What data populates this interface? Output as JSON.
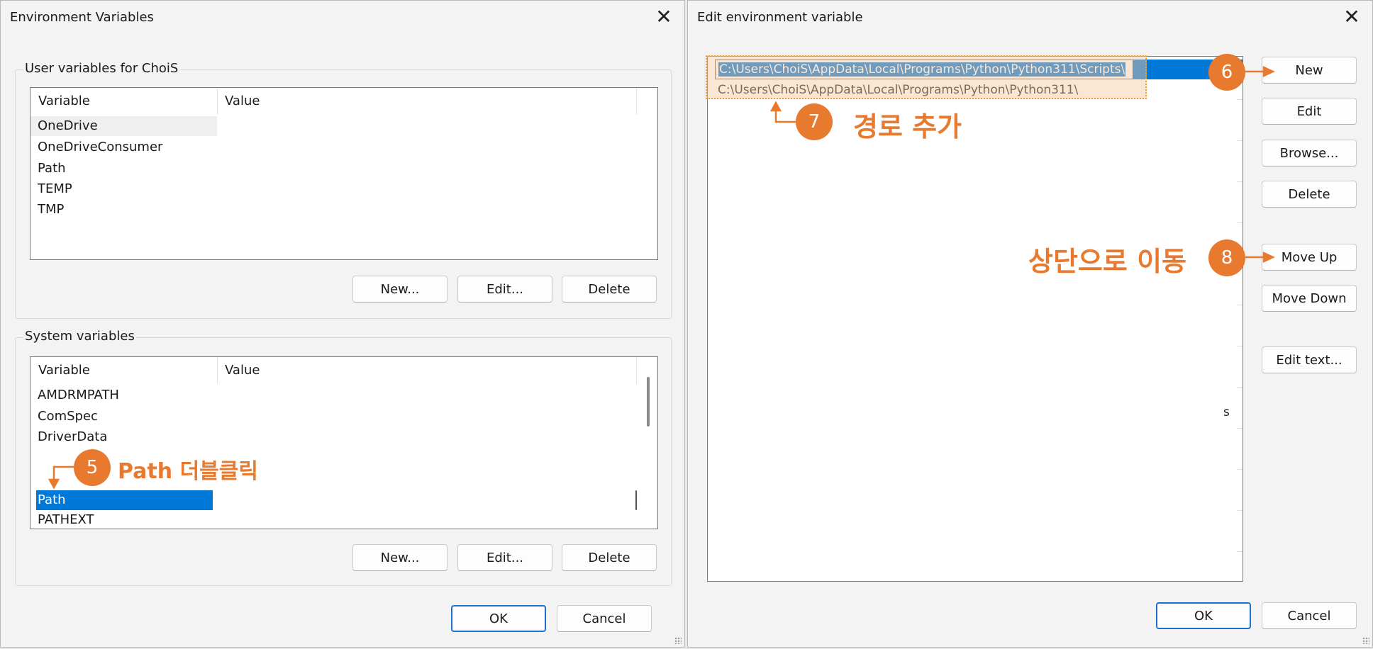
{
  "left_window": {
    "title": "Environment Variables",
    "close_label": "✕",
    "user_group": {
      "label": "User variables for ChoiS",
      "col_variable": "Variable",
      "col_value": "Value",
      "rows": [
        "OneDrive",
        "OneDriveConsumer",
        "Path",
        "TEMP",
        "TMP"
      ],
      "buttons": {
        "new": "New...",
        "edit": "Edit...",
        "delete": "Delete"
      }
    },
    "system_group": {
      "label": "System variables",
      "col_variable": "Variable",
      "col_value": "Value",
      "rows": [
        "AMDRMPATH",
        "ComSpec",
        "DriverData",
        "Path",
        "PATHEXT"
      ],
      "selected_row": "Path",
      "buttons": {
        "new": "New...",
        "edit": "Edit...",
        "delete": "Delete"
      }
    },
    "ok": "OK",
    "cancel": "Cancel"
  },
  "right_window": {
    "title": "Edit environment variable",
    "close_label": "✕",
    "paths": [
      "C:\\Users\\ChoiS\\AppData\\Local\\Programs\\Python\\Python311\\Scripts\\",
      "C:\\Users\\ChoiS\\AppData\\Local\\Programs\\Python\\Python311\\"
    ],
    "partial_text": "s",
    "buttons": {
      "new": "New",
      "edit": "Edit",
      "browse": "Browse...",
      "delete": "Delete",
      "move_up": "Move Up",
      "move_down": "Move Down",
      "edit_text": "Edit text..."
    },
    "ok": "OK",
    "cancel": "Cancel"
  },
  "annotations": {
    "step5_number": "5",
    "step5_text": "Path 더블클릭",
    "step6_number": "6",
    "step7_number": "7",
    "step7_text": "경로 추가",
    "step8_number": "8",
    "step8_text": "상단으로 이동",
    "accent_color": "#e87a2f",
    "selection_color": "#0078d7"
  }
}
